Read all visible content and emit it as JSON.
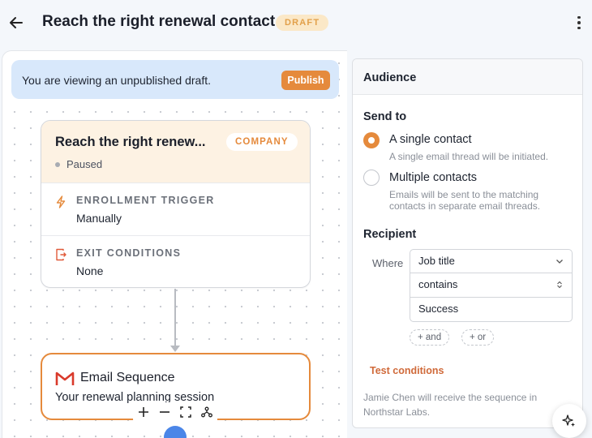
{
  "header": {
    "title": "Reach the right renewal contact",
    "status_badge": "DRAFT"
  },
  "banner": {
    "text": "You are viewing an unpublished draft.",
    "publish_label": "Publish"
  },
  "workflow_card": {
    "title": "Reach the right renew...",
    "object_badge": "COMPANY",
    "status": "Paused",
    "enrollment_label": "ENROLLMENT TRIGGER",
    "enrollment_value": "Manually",
    "exit_label": "EXIT CONDITIONS",
    "exit_value": "None"
  },
  "email_card": {
    "title": "Email Sequence",
    "subject": "Your renewal planning session"
  },
  "panel": {
    "title": "Audience",
    "send_to_label": "Send to",
    "options": [
      {
        "label": "A single contact",
        "help": "A single email thread will be initiated.",
        "selected": true
      },
      {
        "label": "Multiple contacts",
        "help_line1": "Emails will be sent to the matching",
        "help_line2": "contacts in separate email threads.",
        "selected": false
      }
    ],
    "recipient_label": "Recipient",
    "where_label": "Where",
    "property_value": "Job title",
    "operator_value": "contains",
    "match_value": "Success",
    "and_label": "+ and",
    "or_label": "+ or",
    "test_conditions_label": "Test conditions",
    "footer_line1": "Jamie Chen will receive the sequence in",
    "footer_line2": "Northstar Labs."
  },
  "icons": {
    "back": "arrow-left-icon",
    "menu": "kebab-menu-icon",
    "trigger": "lightning-bolt-icon",
    "exit": "exit-door-icon",
    "email": "gmail-icon",
    "assistant": "sparkle-icon"
  },
  "colors": {
    "accent": "#e58a3c",
    "banner_bg": "#d8e8fb",
    "card_header_bg": "#fdf2e3",
    "draft_badge_bg": "#fbe8c7",
    "link": "#d06a3a"
  }
}
